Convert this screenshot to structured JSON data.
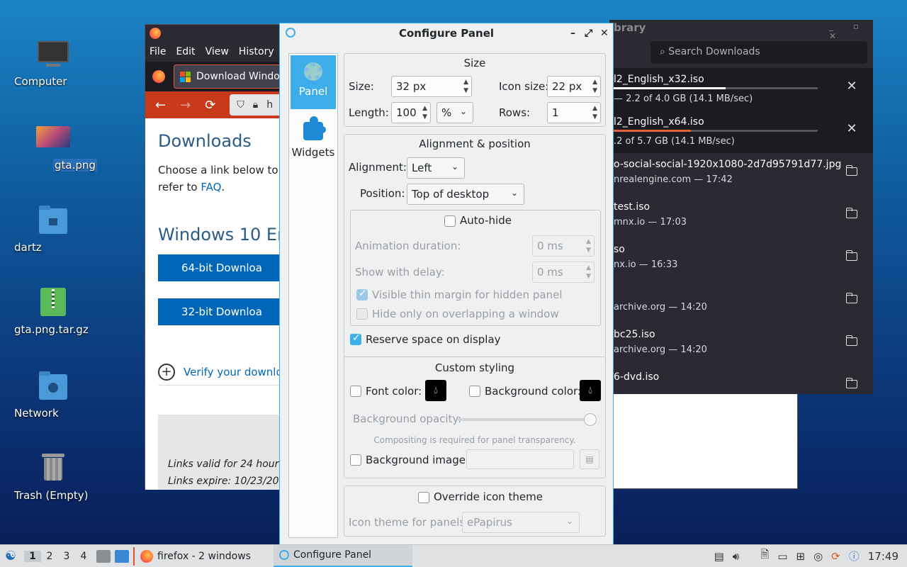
{
  "desktop": {
    "icons": [
      {
        "label": "Computer"
      },
      {
        "label": "gta.png"
      },
      {
        "label": "dartz"
      },
      {
        "label": "gta.png.tar.gz"
      },
      {
        "label": "Network"
      },
      {
        "label": "Trash (Empty)"
      }
    ]
  },
  "firefox": {
    "menu": [
      "File",
      "Edit",
      "View",
      "History",
      "B"
    ],
    "tab_title": "Download Windo",
    "url_partial": "h",
    "page": {
      "heading": "Downloads",
      "intro_line1": "Choose a link below to b",
      "intro_line2_prefix": "refer to ",
      "faq_link": "FAQ",
      "intro_line2_suffix": ".",
      "section_heading": "Windows 10 Eng",
      "btn_64": "64-bit Downloa",
      "btn_32": "32-bit Downloa",
      "verify": "Verify your downlo",
      "links_valid": "Links valid for 24 hour",
      "links_expire": "Links expire: 10/23/20"
    }
  },
  "library": {
    "title": "brary",
    "search_placeholder": "Search Downloads",
    "items": [
      {
        "name": "l2_English_x32.iso",
        "status": "— 2.2 of 4.0 GB (14.1 MB/sec)",
        "progress": 0.55,
        "action": "cancel"
      },
      {
        "name": "l2_English_x64.iso",
        "status": ".2 of 5.7 GB (14.1 MB/sec)",
        "progress": 0.38,
        "action": "cancel"
      },
      {
        "name": "o-social-social-1920x1080-2d7d95791d77.jpg",
        "status": "nrealengine.com — 17:42",
        "action": "folder"
      },
      {
        "name": "test.iso",
        "status": "mnx.io — 17:03",
        "action": "folder"
      },
      {
        "name": "so",
        "status": "nx.io — 16:33",
        "action": "folder"
      },
      {
        "name": "",
        "status": "archive.org — 14:20",
        "action": "folder"
      },
      {
        "name": "bc25.iso",
        "status": "archive.org — 14:20",
        "action": "folder"
      },
      {
        "name": "6-dvd.iso",
        "status": "",
        "action": "folder"
      }
    ]
  },
  "configure_panel": {
    "title": "Configure Panel",
    "sidebar": {
      "panel": "Panel",
      "widgets": "Widgets"
    },
    "size": {
      "title": "Size",
      "size_label": "Size:",
      "size_value": "32 px",
      "icon_size_label": "Icon size:",
      "icon_size_value": "22 px",
      "length_label": "Length:",
      "length_value": "100",
      "length_unit": "%",
      "rows_label": "Rows:",
      "rows_value": "1"
    },
    "alignment": {
      "title": "Alignment & position",
      "alignment_label": "Alignment:",
      "alignment_value": "Left",
      "position_label": "Position:",
      "position_value": "Top of desktop",
      "autohide_label": "Auto-hide",
      "anim_label": "Animation duration:",
      "anim_value": "0 ms",
      "delay_label": "Show with delay:",
      "delay_value": "0 ms",
      "thin_margin_label": "Visible thin margin for hidden panel",
      "hide_overlap_label": "Hide only on overlapping a window",
      "reserve_label": "Reserve space on display"
    },
    "styling": {
      "title": "Custom styling",
      "font_color_label": "Font color:",
      "bg_color_label": "Background color:",
      "opacity_label": "Background opacity:",
      "opacity_value": 1.0,
      "compositing_note": "Compositing is required for panel transparency.",
      "bg_image_label": "Background image:"
    },
    "icon_theme": {
      "override_label": "Override icon theme",
      "theme_label": "Icon theme for panels:",
      "theme_value": "ePapirus"
    }
  },
  "taskbar": {
    "desktops": [
      "1",
      "2",
      "3",
      "4"
    ],
    "tasks": [
      {
        "label": "firefox - 2 windows"
      },
      {
        "label": "Configure Panel"
      }
    ],
    "clock": "17:49"
  }
}
